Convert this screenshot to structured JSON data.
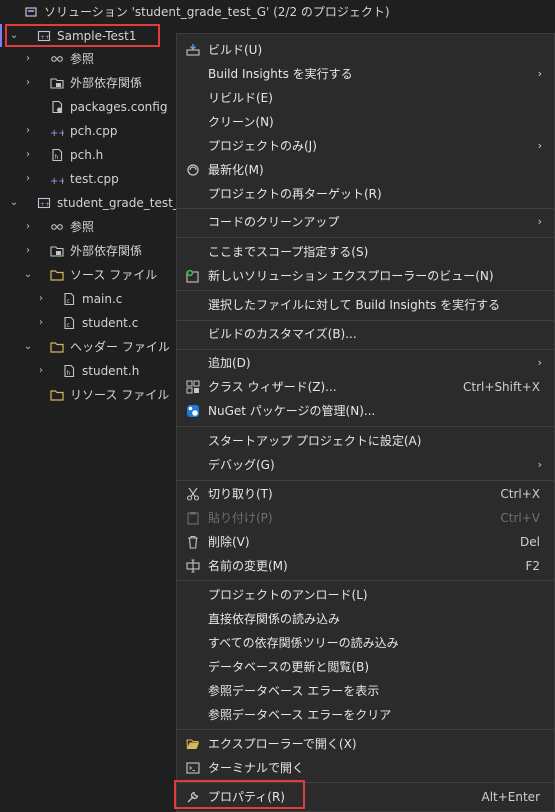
{
  "solution": {
    "label": "ソリューション 'student_grade_test_G' (2/2 のプロジェクト)"
  },
  "tree": {
    "project1": {
      "name": "Sample-Test1",
      "items": [
        {
          "label": "参照"
        },
        {
          "label": "外部依存関係"
        },
        {
          "label": "packages.config"
        },
        {
          "label": "pch.cpp"
        },
        {
          "label": "pch.h"
        },
        {
          "label": "test.cpp"
        }
      ]
    },
    "project2": {
      "name": "student_grade_test_G",
      "ref": "参照",
      "deps": "外部依存関係",
      "source_folder": "ソース ファイル",
      "source_files": [
        "main.c",
        "student.c"
      ],
      "header_folder": "ヘッダー ファイル",
      "header_files": [
        "student.h"
      ],
      "resource_folder": "リソース ファイル"
    }
  },
  "menu": {
    "build": "ビルド(U)",
    "build_insights": "Build Insights を実行する",
    "rebuild": "リビルド(E)",
    "clean": "クリーン(N)",
    "project_only": "プロジェクトのみ(J)",
    "refresh": "最新化(M)",
    "retarget": "プロジェクトの再ターゲット(R)",
    "code_cleanup": "コードのクリーンアップ",
    "scope_to_this": "ここまでスコープ指定する(S)",
    "new_view": "新しいソリューション エクスプローラーのビュー(N)",
    "build_insights_selected": "選択したファイルに対して Build Insights を実行する",
    "build_customize": "ビルドのカスタマイズ(B)...",
    "add": "追加(D)",
    "class_wizard": "クラス ウィザード(Z)...",
    "class_wizard_sc": "Ctrl+Shift+X",
    "nuget": "NuGet パッケージの管理(N)...",
    "startup": "スタートアップ プロジェクトに設定(A)",
    "debug": "デバッグ(G)",
    "cut": "切り取り(T)",
    "cut_sc": "Ctrl+X",
    "paste": "貼り付け(P)",
    "paste_sc": "Ctrl+V",
    "delete": "削除(V)",
    "delete_sc": "Del",
    "rename": "名前の変更(M)",
    "rename_sc": "F2",
    "unload": "プロジェクトのアンロード(L)",
    "load_direct": "直接依存関係の読み込み",
    "load_all": "すべての依存関係ツリーの読み込み",
    "db_update": "データベースの更新と閲覧(B)",
    "show_db_errors": "参照データベース エラーを表示",
    "clear_db_errors": "参照データベース エラーをクリア",
    "open_explorer": "エクスプローラーで開く(X)",
    "open_terminal": "ターミナルで開く",
    "properties": "プロパティ(R)",
    "properties_sc": "Alt+Enter"
  },
  "icons": {
    "chevron_right": "›",
    "chevron_down": "⌄",
    "submenu_arrow": "›"
  },
  "colors": {
    "highlight_box": "#e23b3b",
    "selection_bar": "#7f7ff0"
  }
}
